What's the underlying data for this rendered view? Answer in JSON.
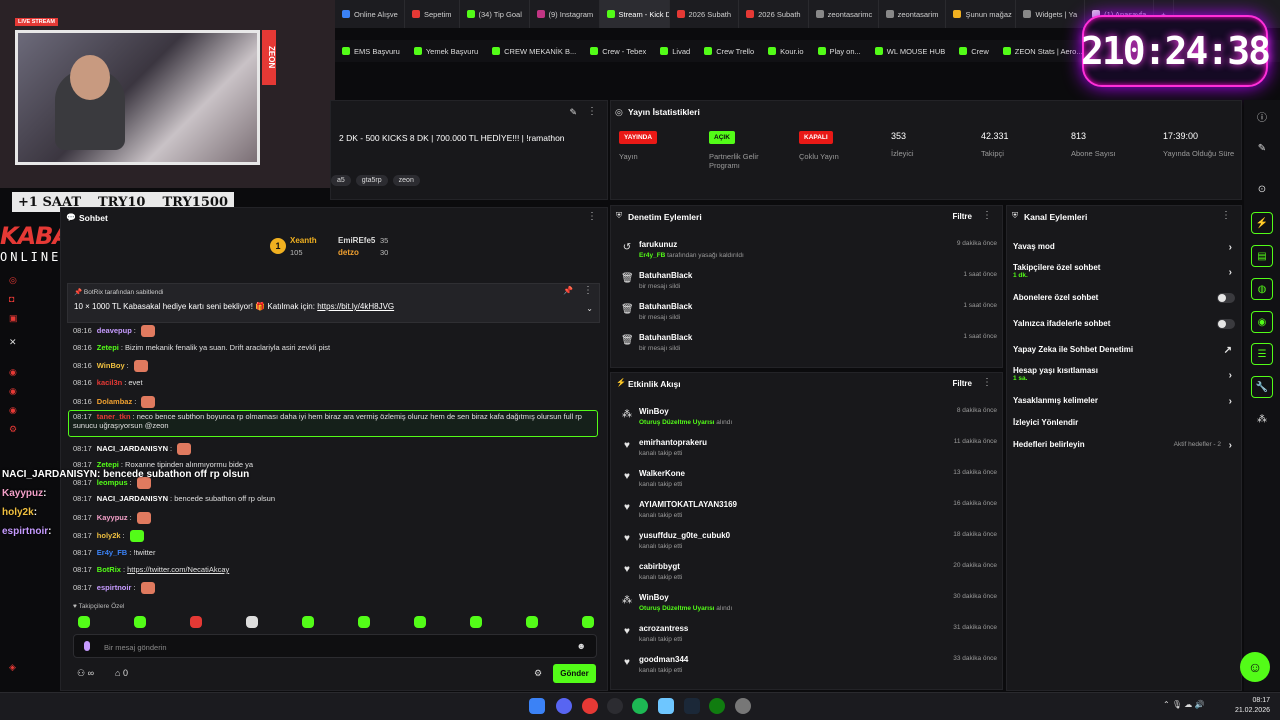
{
  "browser": {
    "tabs": [
      "Online Alışve",
      "Sepetim",
      "(34) Tip Goal",
      "(9) Instagram",
      "Stream - Kick Dashbo",
      "2026 Subath",
      "2026 Subath",
      "zeontasarimc",
      "zeontasarim",
      "Şunun mağaz",
      "Widgets | Ya",
      "(1) Anasayfa"
    ],
    "active_tab": 4,
    "new_tab": "+",
    "bookmarks": [
      "EMS Başvuru",
      "Yemek Başvuru",
      "CREW MEKANİK B...",
      "Crew - Tebex",
      "Livad",
      "Crew Trello",
      "Kour.io",
      "Play on...",
      "WL MOUSE HUB",
      "Crew",
      "ZEON Stats | Aero...",
      "APIq"
    ]
  },
  "overlay": {
    "live_badge": "LIVE STREAM",
    "zeon": "ZEON",
    "price_bar": [
      "+1 SAAT",
      "TRY10",
      "TRY1500"
    ],
    "brand_top": "KABASAKAL",
    "brand_bottom": "ONLINE.COM",
    "timer": "210:24:38",
    "chat_names": [
      {
        "name": "NACI_JARDANISYN",
        "text": ": bencede subathon off rp olsun",
        "color": "#ffffff"
      },
      {
        "name": "Kayypuz",
        "text": ":",
        "color": "#f3a0c8"
      },
      {
        "name": "holy2k",
        "text": ":",
        "color": "#f0c040"
      },
      {
        "name": "espirtnoir",
        "text": ":",
        "color": "#c69bff"
      }
    ]
  },
  "stream_info": {
    "title": "2 DK - 500 KICKS 8 DK | 700.000 TL HEDİYE!!! | !ramathon",
    "tags": [
      "a5",
      "gta5rp",
      "zeon"
    ]
  },
  "stats": {
    "heading": "Yayın İstatistikleri",
    "items": [
      {
        "badge": "YAYINDA",
        "badge_color": "red",
        "label": "Yayın"
      },
      {
        "badge": "AÇIK",
        "badge_color": "green",
        "label": "Partnerlik Gelir Programı"
      },
      {
        "badge": "KAPALI",
        "badge_color": "red",
        "label": "Çoklu Yayın"
      },
      {
        "value": "353",
        "label": "İzleyici"
      },
      {
        "value": "42.331",
        "label": "Takipçi"
      },
      {
        "value": "813",
        "label": "Abone Sayısı"
      },
      {
        "value": "17:39:00",
        "label": "Yayında Olduğu Süre"
      }
    ]
  },
  "chat": {
    "heading": "Sohbet",
    "leaderboard": [
      {
        "rank": "1",
        "name": "Xeanth",
        "count": "105"
      },
      {
        "name": "EmiREfe5",
        "count": "35"
      },
      {
        "name": "detzo",
        "count": "30"
      }
    ],
    "pinned_by": "BotRix tarafından sabitlendi",
    "pinned_text": "10 × 1000 TL Kabasakal hediye kartı seni bekliyor! 🎁 Katılmak için:",
    "pinned_link": "https://bit.ly/4kH8JVG",
    "messages": [
      {
        "time": "08:16",
        "user": "deavepup",
        "text": "",
        "color": "#c69bff"
      },
      {
        "time": "08:16",
        "user": "Zetepi",
        "text": "Bizim mekanik fenalik ya suan. Drift araclariyla asiri zevkli pist",
        "color": "#53fc18"
      },
      {
        "time": "08:16",
        "user": "WinBoy",
        "text": "",
        "color": "#f0c040"
      },
      {
        "time": "08:16",
        "user": "kacil3n",
        "text": "evet",
        "color": "#e53935"
      },
      {
        "time": "08:16",
        "user": "Dolambaz",
        "text": "",
        "color": "#f0a030"
      },
      {
        "time": "08:17",
        "user": "taner_tkn",
        "text": "neco bence subthon boyunca rp olmaması daha iyi hem biraz ara vermiş özlemiş oluruz hem de sen biraz kafa dağıtmış olursun full rp sunucu uğraşıyorsun @zeon",
        "color": "#e53935"
      },
      {
        "time": "08:17",
        "user": "NACI_JARDANISYN",
        "text": "",
        "color": "#ffffff"
      },
      {
        "time": "08:17",
        "user": "Zetepi",
        "text": "Roxanne tipinden alınmıyormu bide ya",
        "color": "#53fc18"
      },
      {
        "time": "08:17",
        "user": "leompus",
        "text": "",
        "color": "#53fc18"
      },
      {
        "time": "08:17",
        "user": "NACI_JARDANISYN",
        "text": "bencede subathon off rp olsun",
        "color": "#ffffff"
      },
      {
        "time": "08:17",
        "user": "Kayypuz",
        "text": "",
        "color": "#f3a0c8"
      },
      {
        "time": "08:17",
        "user": "holy2k",
        "text": "",
        "color": "#f0c040"
      },
      {
        "time": "08:17",
        "user": "Er4y_FB",
        "text": "!twitter",
        "color": "#3b82f6"
      },
      {
        "time": "08:17",
        "user": "BotRix",
        "text": "https://twitter.com/NecatiAkcay",
        "color": "#53fc18"
      },
      {
        "time": "08:17",
        "user": "espirtnoir",
        "text": "",
        "color": "#c69bff"
      }
    ],
    "followers_only": "Takipçilere Özel",
    "input_placeholder": "Bir mesaj gönderin",
    "send": "Gönder",
    "infinity": "∞",
    "gift_count": "0"
  },
  "moderation": {
    "heading": "Denetim Eylemleri",
    "filter": "Filtre",
    "items": [
      {
        "icon": "↺",
        "name": "farukunuz",
        "pre": "Er4y_FB",
        "sub": " tarafından yasağı kaldırıldı",
        "time": "9 dakika önce"
      },
      {
        "icon": "🗑",
        "name": "BatuhanBlack",
        "pre": "",
        "sub": "bir mesajı sildi",
        "time": "1 saat önce"
      },
      {
        "icon": "🗑",
        "name": "BatuhanBlack",
        "pre": "",
        "sub": "bir mesajı sildi",
        "time": "1 saat önce"
      },
      {
        "icon": "🗑",
        "name": "BatuhanBlack",
        "pre": "",
        "sub": "bir mesajı sildi",
        "time": "1 saat önce"
      }
    ]
  },
  "activity": {
    "heading": "Etkinlik Akışı",
    "filter": "Filtre",
    "items": [
      {
        "icon": "gift",
        "name": "WinBoy",
        "pre": "Oturuş Düzeltme Uyarısı",
        "sub": " alındı",
        "time": "8 dakika önce"
      },
      {
        "icon": "heart",
        "name": "emirhantoprakeru",
        "pre": "",
        "sub": "kanalı takip etti",
        "time": "11 dakika önce"
      },
      {
        "icon": "heart",
        "name": "WalkerKone",
        "pre": "",
        "sub": "kanalı takip etti",
        "time": "13 dakika önce"
      },
      {
        "icon": "heart",
        "name": "AYIAMITOKATLAYAN3169",
        "pre": "",
        "sub": "kanalı takip etti",
        "time": "16 dakika önce"
      },
      {
        "icon": "heart",
        "name": "yusuffduz_g0te_cubuk0",
        "pre": "",
        "sub": "kanalı takip etti",
        "time": "18 dakika önce"
      },
      {
        "icon": "heart",
        "name": "cabirbbygt",
        "pre": "",
        "sub": "kanalı takip etti",
        "time": "20 dakika önce"
      },
      {
        "icon": "gift",
        "name": "WinBoy",
        "pre": "Oturuş Düzeltme Uyarısı",
        "sub": " alındı",
        "time": "30 dakika önce"
      },
      {
        "icon": "heart",
        "name": "acrozantress",
        "pre": "",
        "sub": "kanalı takip etti",
        "time": "31 dakika önce"
      },
      {
        "icon": "heart",
        "name": "goodman344",
        "pre": "",
        "sub": "kanalı takip etti",
        "time": "33 dakika önce"
      }
    ]
  },
  "channel": {
    "heading": "Kanal Eylemleri",
    "items": [
      {
        "label": "Yavaş mod",
        "sub": "",
        "ctrl": "chev"
      },
      {
        "label": "Takipçilere özel sohbet",
        "sub": "1 dk.",
        "ctrl": "chev"
      },
      {
        "label": "Abonelere özel sohbet",
        "sub": "",
        "ctrl": "toggle"
      },
      {
        "label": "Yalnızca ifadelerle sohbet",
        "sub": "",
        "ctrl": "toggle"
      },
      {
        "label": "Yapay Zeka ile Sohbet Denetimi",
        "sub": "",
        "ctrl": "ext"
      },
      {
        "label": "Hesap yaşı kısıtlaması",
        "sub": "1 sa.",
        "ctrl": "chev"
      },
      {
        "label": "Yasaklanmış kelimeler",
        "sub": "",
        "ctrl": "chev"
      },
      {
        "label": "İzleyici Yönlendir",
        "sub": "",
        "ctrl": ""
      },
      {
        "label": "Hedefleri belirleyin",
        "sub": "",
        "ctrl": "chev"
      }
    ],
    "goals_status": "Aktif hedefler - 2"
  },
  "taskbar": {
    "time": "08:17",
    "date": "21.02.2026"
  }
}
